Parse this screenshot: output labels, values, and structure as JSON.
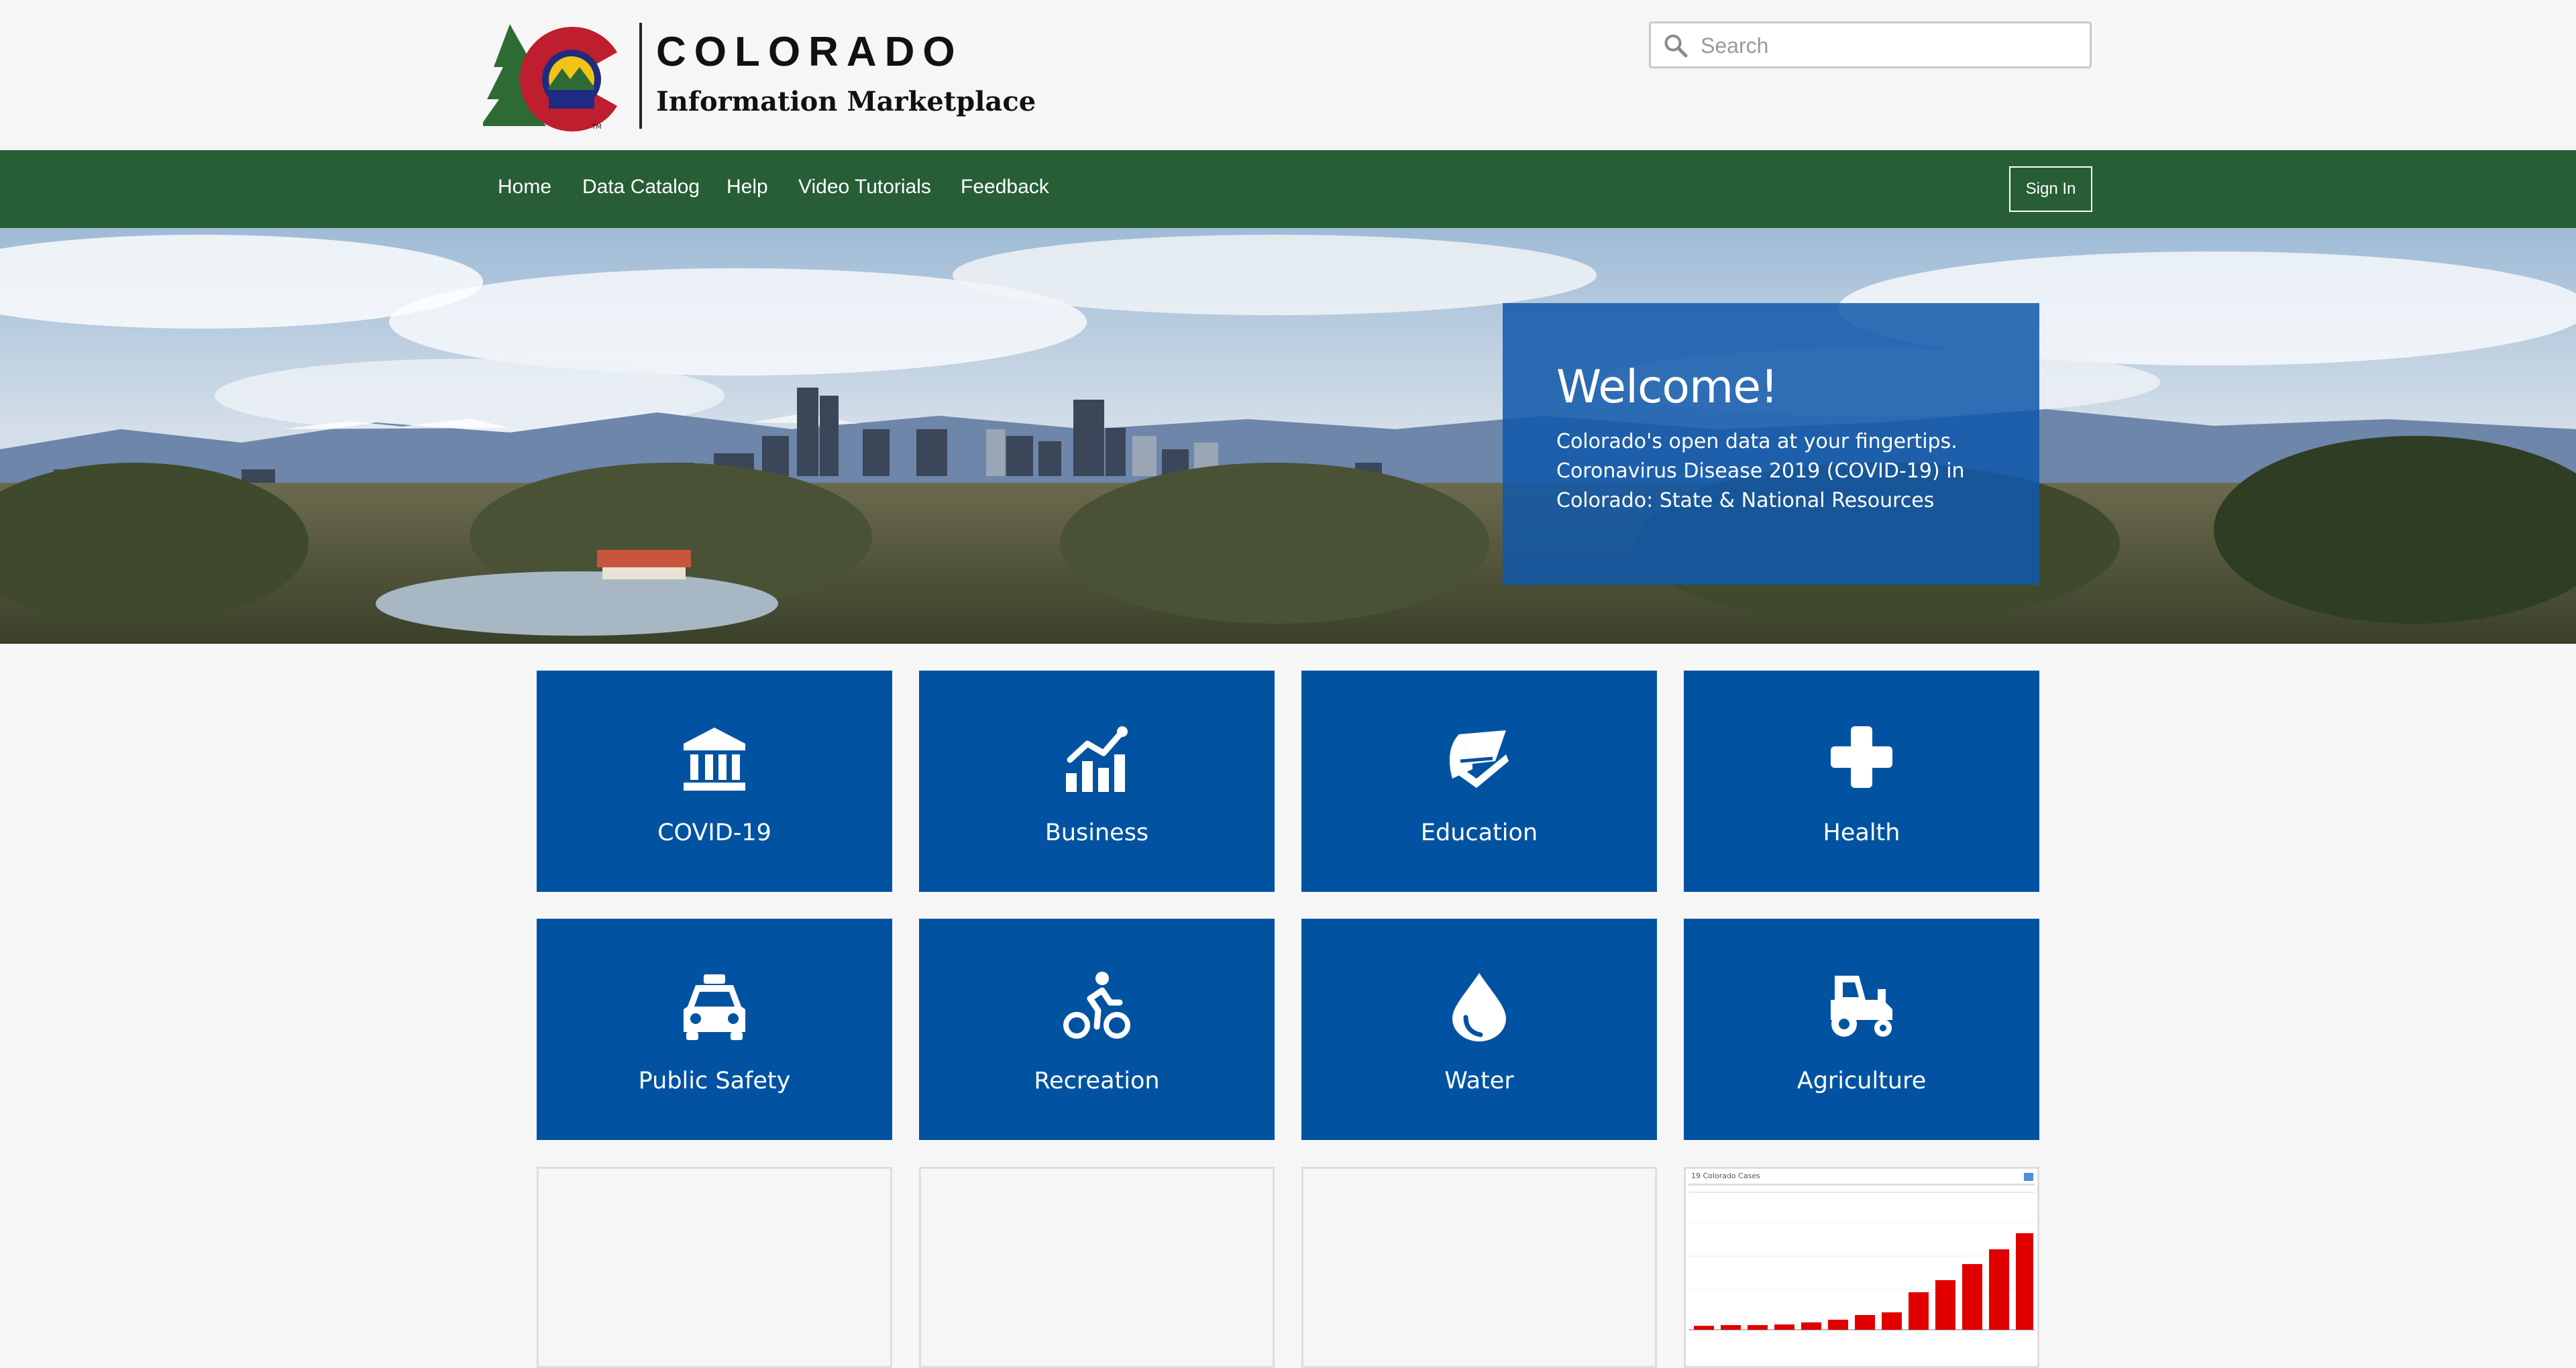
{
  "header": {
    "logo_title": "COLORADO",
    "logo_subtitle": "Information Marketplace",
    "search_placeholder": "Search"
  },
  "nav": {
    "items": [
      {
        "label": "Home"
      },
      {
        "label": "Data Catalog"
      },
      {
        "label": "Help"
      },
      {
        "label": "Video Tutorials"
      },
      {
        "label": "Feedback"
      }
    ],
    "signin_label": "Sign In"
  },
  "hero": {
    "title": "Welcome!",
    "body": "Colorado's open data at your fingertips. Coronavirus Disease 2019 (COVID-19) in Colorado: State & National Resources"
  },
  "categories": [
    {
      "label": "COVID-19",
      "icon": "bank-icon"
    },
    {
      "label": "Business",
      "icon": "chart-line-icon"
    },
    {
      "label": "Education",
      "icon": "book-icon"
    },
    {
      "label": "Health",
      "icon": "plus-icon"
    },
    {
      "label": "Public Safety",
      "icon": "taxi-icon"
    },
    {
      "label": "Recreation",
      "icon": "bicycle-icon"
    },
    {
      "label": "Water",
      "icon": "droplet-icon"
    },
    {
      "label": "Agriculture",
      "icon": "tractor-icon"
    }
  ],
  "colors": {
    "nav_green": "#275e35",
    "tile_blue": "#0153a1",
    "welcome_blue": "#1058aa",
    "chart_red": "#e00000"
  },
  "featured_chart": {
    "title": "19 Colorado Cases"
  }
}
